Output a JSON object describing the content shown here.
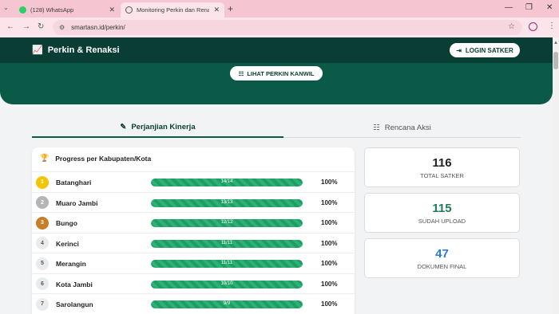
{
  "browser": {
    "tabs": [
      {
        "label": "(128) WhatsApp",
        "close": "✕"
      },
      {
        "label": "Monitoring Perkin dan Renaksi",
        "close": "✕"
      }
    ],
    "new_tab": "+",
    "tab_search": "⌄",
    "window_controls": {
      "minimize": "—",
      "restore": "❐",
      "close": "✕"
    },
    "nav": {
      "back": "←",
      "forward": "→",
      "reload": "↻"
    },
    "url": "smartasn.id/perkin/",
    "star": "☆",
    "menu": "⋮"
  },
  "header": {
    "brand_icon": "📈",
    "brand": "Perkin & Renaksi",
    "login_icon": "⇥",
    "login_label": "LOGIN SATKER",
    "kanwil_icon": "☷",
    "kanwil_label": "LIHAT PERKIN KANWIL"
  },
  "tabs": [
    {
      "icon": "✎",
      "label": "Perjanjian Kinerja",
      "active": true
    },
    {
      "icon": "☷",
      "label": "Rencana Aksi",
      "active": false
    }
  ],
  "progress": {
    "icon": "🏆",
    "title": "Progress per Kabupaten/Kota",
    "rows": [
      {
        "rank": "1",
        "name": "Batanghari",
        "bar": "14/14",
        "fraction": 1.0,
        "pct": "100%"
      },
      {
        "rank": "2",
        "name": "Muaro Jambi",
        "bar": "13/13",
        "fraction": 1.0,
        "pct": "100%"
      },
      {
        "rank": "3",
        "name": "Bungo",
        "bar": "12/12",
        "fraction": 1.0,
        "pct": "100%"
      },
      {
        "rank": "4",
        "name": "Kerinci",
        "bar": "11/11",
        "fraction": 1.0,
        "pct": "100%"
      },
      {
        "rank": "5",
        "name": "Merangin",
        "bar": "11/11",
        "fraction": 1.0,
        "pct": "100%"
      },
      {
        "rank": "6",
        "name": "Kota Jambi",
        "bar": "10/10",
        "fraction": 1.0,
        "pct": "100%"
      },
      {
        "rank": "7",
        "name": "Sarolangun",
        "bar": "9/9",
        "fraction": 1.0,
        "pct": "100%"
      }
    ],
    "rank_colors": {
      "1": "#f5c400",
      "2": "#b5b5b5",
      "3": "#c77d2a"
    }
  },
  "stats": [
    {
      "value": "116",
      "label": "TOTAL SATKER",
      "color": "#222222"
    },
    {
      "value": "115",
      "label": "SUDAH UPLOAD",
      "color": "#1e7d55"
    },
    {
      "value": "47",
      "label": "DOKUMEN FINAL",
      "color": "#2a7bd6"
    }
  ]
}
